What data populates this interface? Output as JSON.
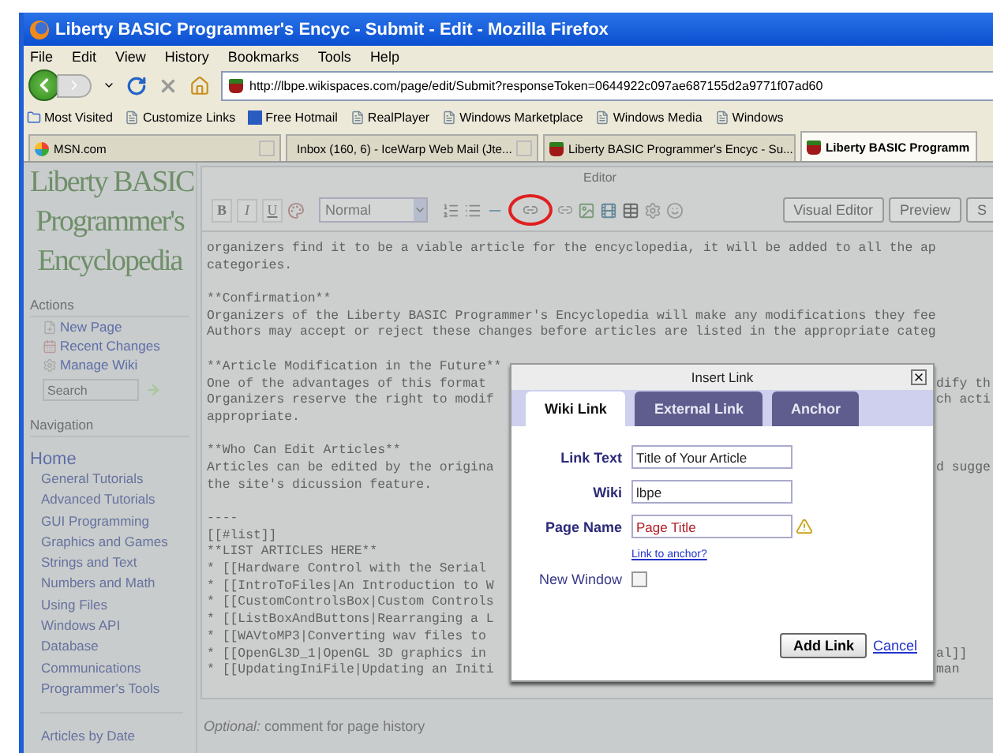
{
  "window": {
    "title": "Liberty BASIC Programmer's Encyc - Submit - Edit - Mozilla Firefox"
  },
  "menu": [
    "File",
    "Edit",
    "View",
    "History",
    "Bookmarks",
    "Tools",
    "Help"
  ],
  "address": {
    "value": "http://lbpe.wikispaces.com/page/edit/Submit?responseToken=0644922c097ae687155d2a9771f07ad60"
  },
  "bookmarks": [
    {
      "label": "Most Visited",
      "kind": "folder"
    },
    {
      "label": "Customize Links",
      "kind": "page"
    },
    {
      "label": "Free Hotmail",
      "kind": "mail"
    },
    {
      "label": "RealPlayer",
      "kind": "page"
    },
    {
      "label": "Windows Marketplace",
      "kind": "page"
    },
    {
      "label": "Windows Media",
      "kind": "page"
    },
    {
      "label": "Windows",
      "kind": "page"
    }
  ],
  "tabs": [
    {
      "label": "MSN.com",
      "selected": false,
      "kind": "msn"
    },
    {
      "label": "Inbox (160, 6) - IceWarp Web Mail (Jte...",
      "selected": false,
      "kind": "page"
    },
    {
      "label": "Liberty BASIC Programmer's Encyc - Su...",
      "selected": false,
      "kind": "wiki"
    },
    {
      "label": "Liberty BASIC Programm",
      "selected": true,
      "kind": "wiki"
    }
  ],
  "sidebar": {
    "logo": [
      "Liberty BASIC",
      "Programmer's",
      "Encyclopedia"
    ],
    "actions_heading": "Actions",
    "actions": [
      {
        "label": "New Page",
        "kind": "new"
      },
      {
        "label": "Recent Changes",
        "kind": "recent"
      },
      {
        "label": "Manage Wiki",
        "kind": "manage"
      }
    ],
    "search": {
      "placeholder": "Search"
    },
    "navigation_heading": "Navigation",
    "home": "Home",
    "items": [
      "General Tutorials",
      "Advanced Tutorials",
      "GUI Programming",
      "Graphics and Games",
      "Strings and Text",
      "Numbers and Math",
      "Using Files",
      "Windows API",
      "Database",
      "Communications",
      "Programmer's Tools"
    ],
    "footer_link": "Articles by Date"
  },
  "editor": {
    "title": "Editor",
    "format_buttons": [
      "B",
      "I",
      "U"
    ],
    "style_select": "Normal",
    "buttons": [
      "Visual Editor",
      "Preview",
      "S"
    ],
    "paragraphs": [
      [
        {
          "text": "organizers find it to be a viable article for the encyclopedia, it will be added to all the ap"
        },
        {
          "text": "categories."
        }
      ],
      [
        {
          "text": "**Confirmation**"
        },
        {
          "text": "Organizers of the Liberty BASIC Programmer's Encyclopedia will make any modifications they fee"
        },
        {
          "text": "Authors may accept or reject these changes before articles are listed in the appropriate categ"
        }
      ],
      [
        {
          "text": "**Article Modification in the Future**"
        },
        {
          "text": "One of the advantages of this format",
          "tail": "dify th"
        },
        {
          "text": "Organizers reserve the right to modif",
          "tail": "ch acti"
        },
        {
          "text": "appropriate."
        }
      ],
      [
        {
          "text": "**Who Can Edit Articles**"
        },
        {
          "text": "Articles can be edited by the origina",
          "tail": "d sugge"
        },
        {
          "text": "the site's dicussion feature."
        }
      ],
      [
        {
          "text": "----"
        },
        {
          "text": "[[#list]]"
        },
        {
          "text": "**LIST ARTICLES HERE**"
        },
        {
          "text": "* [[Hardware Control with the Serial"
        },
        {
          "text": "* [[IntroToFiles|An Introduction to W"
        },
        {
          "text": "* [[CustomControlsBox|Custom Controls"
        },
        {
          "text": "* [[ListBoxAndButtons|Rearranging a L"
        },
        {
          "text": "* [[WAVtoMP3|Converting wav files to"
        },
        {
          "text": "* [[OpenGL3D_1|OpenGL 3D graphics in",
          "tail": "al]]"
        },
        {
          "text": "* [[UpdatingIniFile|Updating an Initi",
          "tail": "man"
        }
      ]
    ],
    "comment_hint": "*Optional:* comment for page history"
  },
  "dialog": {
    "title": "Insert Link",
    "tabs": [
      {
        "label": "Wiki Link",
        "selected": true
      },
      {
        "label": "External Link",
        "selected": false
      },
      {
        "label": "Anchor",
        "selected": false
      }
    ],
    "fields": [
      {
        "label": "Link Text",
        "value": "Title of Your Article",
        "warning": false
      },
      {
        "label": "Wiki",
        "value": "lbpe",
        "warning": false
      },
      {
        "label": "Page Name",
        "value": "Page Title",
        "warning": true
      }
    ],
    "anchor_link": "Link to anchor?",
    "new_window": {
      "label": "New Window",
      "checked": false
    },
    "add_button": "Add Link",
    "cancel": "Cancel"
  }
}
